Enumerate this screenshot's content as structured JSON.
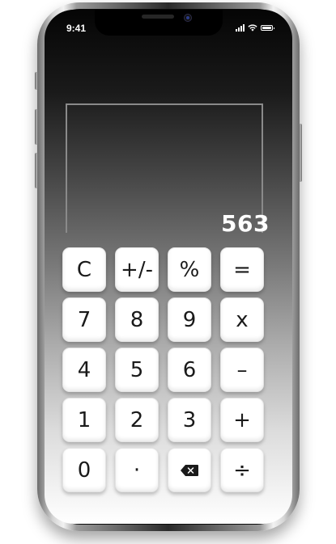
{
  "status_bar": {
    "time": "9:41"
  },
  "display": {
    "value": "563"
  },
  "keypad": {
    "clear": "C",
    "sign": "+/-",
    "percent": "%",
    "equals": "=",
    "seven": "7",
    "eight": "8",
    "nine": "9",
    "multiply": "x",
    "four": "4",
    "five": "5",
    "six": "6",
    "subtract": "–",
    "one": "1",
    "two": "2",
    "three": "3",
    "add": "+",
    "zero": "0",
    "decimal": "·",
    "backspace_icon": "backspace-icon",
    "divide": "÷"
  }
}
